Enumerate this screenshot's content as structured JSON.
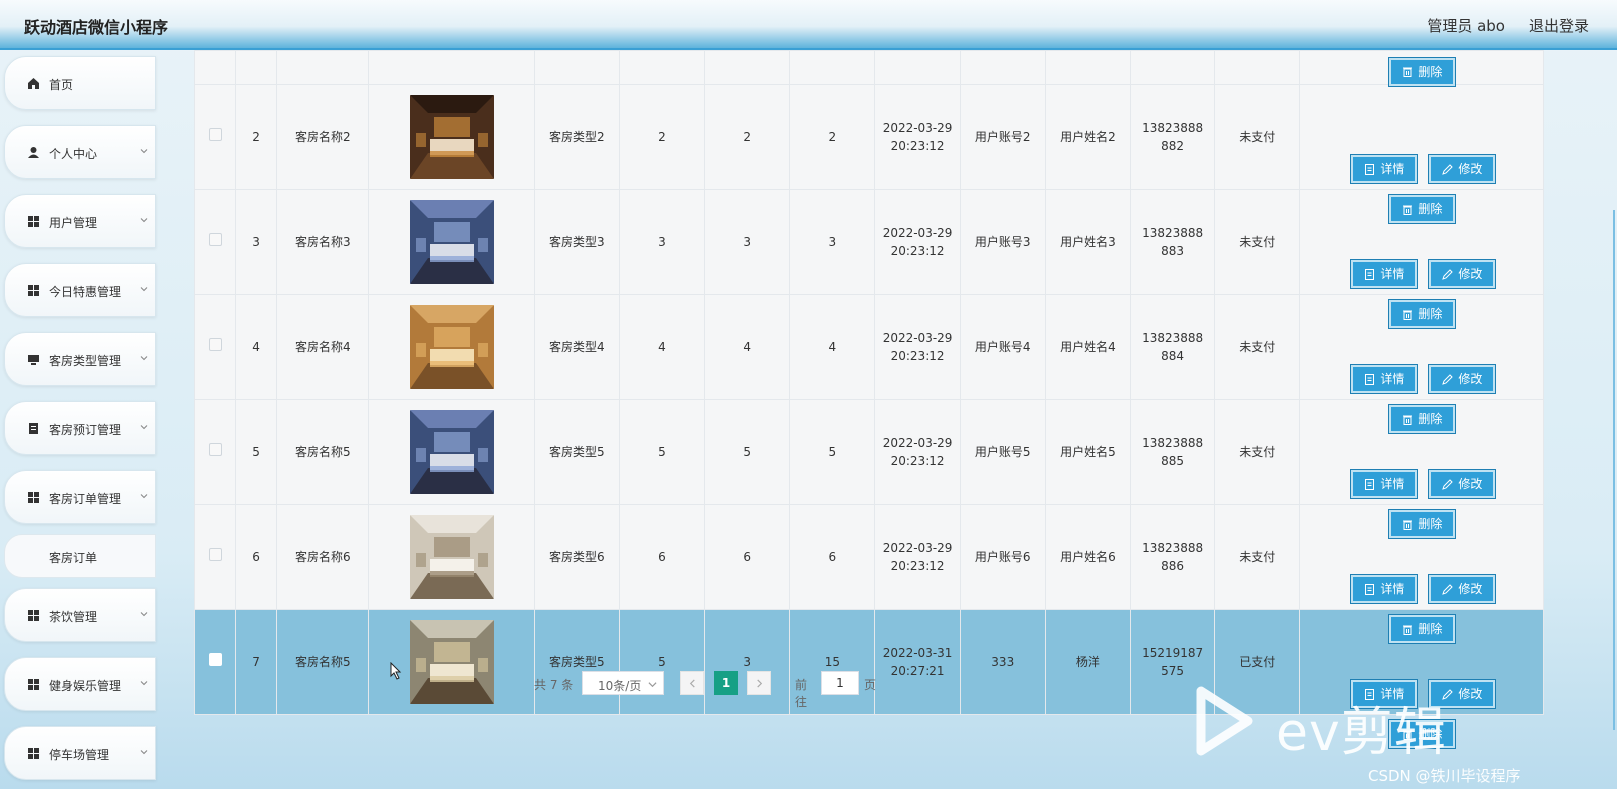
{
  "header": {
    "title": "跃动酒店微信小程序",
    "admin": "管理员 abo",
    "logout": "退出登录"
  },
  "sidebar": {
    "items": [
      {
        "label": "首页",
        "icon": "home-icon",
        "expandable": false
      },
      {
        "label": "个人中心",
        "icon": "person-icon",
        "expandable": true
      },
      {
        "label": "用户管理",
        "icon": "grid-icon",
        "expandable": true
      },
      {
        "label": "今日特惠管理",
        "icon": "grid-icon",
        "expandable": true
      },
      {
        "label": "客房类型管理",
        "icon": "monitor-icon",
        "expandable": true
      },
      {
        "label": "客房预订管理",
        "icon": "clipboard-icon",
        "expandable": true
      },
      {
        "label": "客房订单管理",
        "icon": "grid-icon",
        "expandable": true
      },
      {
        "label": "客房订单",
        "sub": true
      },
      {
        "label": "茶饮管理",
        "icon": "grid-icon",
        "expandable": true
      },
      {
        "label": "健身娱乐管理",
        "icon": "grid-icon",
        "expandable": true
      },
      {
        "label": "停车场管理",
        "icon": "grid-icon",
        "expandable": true
      }
    ]
  },
  "buttons": {
    "detail": "详情",
    "edit": "修改",
    "delete": "删除"
  },
  "table": {
    "rows": [
      {
        "index": "",
        "room_name": "",
        "room_type": "",
        "c1": "",
        "c2": "",
        "c3": "",
        "time": "",
        "account": "",
        "user_name": "",
        "phone": "",
        "status": "",
        "image": "blue-room",
        "partial": true
      },
      {
        "index": "2",
        "room_name": "客房名称2",
        "room_type": "客房类型2",
        "c1": "2",
        "c2": "2",
        "c3": "2",
        "time": "2022-03-29 20:23:12",
        "account": "用户账号2",
        "user_name": "用户姓名2",
        "phone": "13823888882",
        "status": "未支付",
        "image": "dark-room"
      },
      {
        "index": "3",
        "room_name": "客房名称3",
        "room_type": "客房类型3",
        "c1": "3",
        "c2": "3",
        "c3": "3",
        "time": "2022-03-29 20:23:12",
        "account": "用户账号3",
        "user_name": "用户姓名3",
        "phone": "13823888883",
        "status": "未支付",
        "image": "blue-room"
      },
      {
        "index": "4",
        "room_name": "客房名称4",
        "room_type": "客房类型4",
        "c1": "4",
        "c2": "4",
        "c3": "4",
        "time": "2022-03-29 20:23:12",
        "account": "用户账号4",
        "user_name": "用户姓名4",
        "phone": "13823888884",
        "status": "未支付",
        "image": "gold-room"
      },
      {
        "index": "5",
        "room_name": "客房名称5",
        "room_type": "客房类型5",
        "c1": "5",
        "c2": "5",
        "c3": "5",
        "time": "2022-03-29 20:23:12",
        "account": "用户账号5",
        "user_name": "用户姓名5",
        "phone": "13823888885",
        "status": "未支付",
        "image": "blue-room"
      },
      {
        "index": "6",
        "room_name": "客房名称6",
        "room_type": "客房类型6",
        "c1": "6",
        "c2": "6",
        "c3": "6",
        "time": "2022-03-29 20:23:12",
        "account": "用户账号6",
        "user_name": "用户姓名6",
        "phone": "13823888886",
        "status": "未支付",
        "image": "light-room"
      },
      {
        "index": "7",
        "room_name": "客房名称5",
        "room_type": "客房类型5",
        "c1": "5",
        "c2": "3",
        "c3": "15",
        "time": "2022-03-31 20:27:21",
        "account": "333",
        "user_name": "杨洋",
        "phone": "15219187575",
        "status": "已支付",
        "image": "cream-room",
        "selected": true
      }
    ]
  },
  "pagination": {
    "total": "共 7 条",
    "page_size": "10条/页",
    "current_page": "1",
    "goto_label": "前往",
    "goto_value": "1",
    "goto_unit": "页"
  },
  "watermark": {
    "brand": "ev剪辑",
    "csdn": "CSDN @铁川毕设程序"
  },
  "colors": {
    "accent": "#2f9fd8",
    "selected_row": "#86c1dc",
    "page_active": "#16a085"
  }
}
